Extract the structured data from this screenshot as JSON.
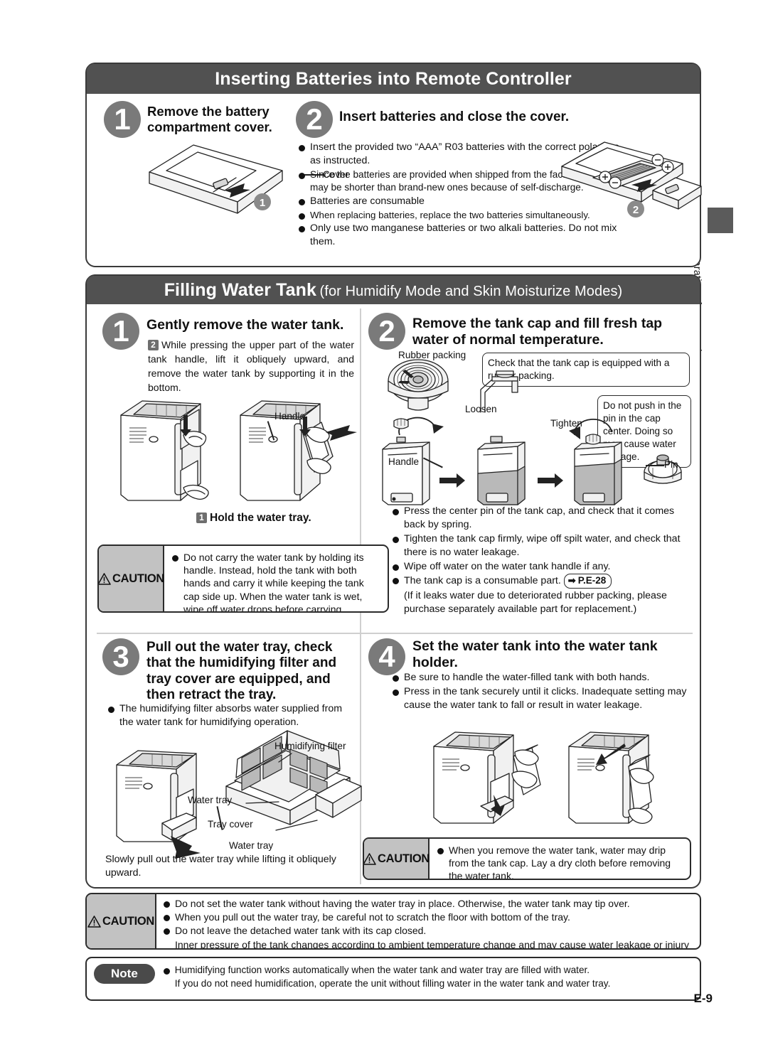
{
  "sidebar": {
    "tab_label": "Preparations for Operation"
  },
  "page_number": "E-9",
  "section_battery": {
    "title": "Inserting Batteries into Remote Controller",
    "step1": {
      "number": "1",
      "title": "Remove the battery compartment cover.",
      "figure_labels": {
        "cover": "Cover",
        "badge": "1"
      }
    },
    "step2": {
      "number": "2",
      "title": "Insert batteries and close the cover.",
      "bullets": [
        "Insert the provided two “AAA” R03 batteries with the correct polarities as instructed.",
        "Since the batteries are provided when shipped from the factory, their lives may be shorter than brand-new ones because of self-discharge.",
        "Batteries are consumable",
        "When replacing batteries, replace the two batteries simultaneously.",
        "Only use two manganese batteries or two alkali batteries. Do not mix them."
      ],
      "figure_labels": {
        "badge": "2"
      }
    }
  },
  "section_tank": {
    "title_bold": "Filling Water Tank",
    "title_rest": "(for Humidify Mode and Skin Moisturize Modes)",
    "step1": {
      "number": "1",
      "title": "Gently remove the water tank.",
      "sub_number": "2",
      "sub_text": "While pressing the upper part of the water tank handle, lift it obliquely upward, and remove the water tank by supporting it in the bottom.",
      "figure_labels": {
        "handle": "Handle"
      },
      "hold_number": "1",
      "hold_text": "Hold the water tray.",
      "caution": {
        "label": "CAUTION",
        "bullets": [
          "Do not carry the water tank by holding its handle. Instead, hold the tank with both hands and carry it while keeping the tank cap side up. When the water tank is wet, wipe off water drops before carrying."
        ]
      }
    },
    "step2": {
      "number": "2",
      "title": "Remove the tank cap and fill fresh tap water of normal temperature.",
      "balloon_packing": "Check that the tank cap is equipped with a rubber packing.",
      "balloon_pin": "Do not push in the pin in the cap center. Doing so may cause water leakage.",
      "figure_labels": {
        "rubber_packing": "Rubber packing",
        "loosen": "Loosen",
        "tighten": "Tighten",
        "handle": "Handle",
        "pin": "Pin"
      },
      "bullets": [
        "Press the center pin of the tank cap, and check that it comes back by spring.",
        "Tighten the tank cap firmly, wipe off spilt water, and check that there is no water leakage.",
        "Wipe off water on the water tank handle if any.",
        "The tank cap is a consumable part."
      ],
      "ref_chip": "P.E-28",
      "ref_tail": "(If it leaks water due to deteriorated rubber packing, please purchase separately available part for replacement.)"
    },
    "step3": {
      "number": "3",
      "title": "Pull out the water tray, check that the humidifying filter and tray cover are equipped, and then retract the tray.",
      "bullets": [
        "The humidifying filter absorbs water supplied from the water tank for humidifying operation."
      ],
      "figure_labels": {
        "humidifying_filter": "Humidifying filter",
        "water_tray_1": "Water tray",
        "tray_cover": "Tray cover",
        "water_tray_2": "Water tray"
      },
      "footer_text": "Slowly pull out the water tray while lifting it obliquely upward."
    },
    "step4": {
      "number": "4",
      "title": "Set the water tank into the water tank holder.",
      "bullets": [
        "Be sure to handle the water-filled tank with both hands.",
        "Press in the tank securely until it clicks. Inadequate setting may cause the water tank to fall or result in water leakage."
      ],
      "caution": {
        "label": "CAUTION",
        "bullets": [
          "When you remove the water tank, water may drip from the tank cap. Lay a dry cloth before removing the water tank."
        ]
      }
    }
  },
  "bottom_caution": {
    "label": "CAUTION",
    "bullets": [
      "Do not set the water tank without having the water tray in place. Otherwise, the water tank may tip over.",
      "When you pull out the water tray, be careful not to scratch the floor with bottom of the tray.",
      "Do not leave the detached water tank with its cap closed."
    ],
    "continuation": "Inner pressure of the tank changes according to ambient temperature change and may cause water leakage or injury due to deformation or damage."
  },
  "note": {
    "label": "Note",
    "bullets": [
      "Humidifying function works automatically when the water tank and water tray are filled with water."
    ],
    "continuation": "If you do not need humidification, operate the unit without filling water in the water tank and water tray."
  },
  "colors": {
    "header_bg": "#515151",
    "step_circle": "#7a7a7a",
    "caution_tag": "#c2c2c2",
    "note_pill": "#4a4a4a",
    "border": "#3a3a3a"
  }
}
